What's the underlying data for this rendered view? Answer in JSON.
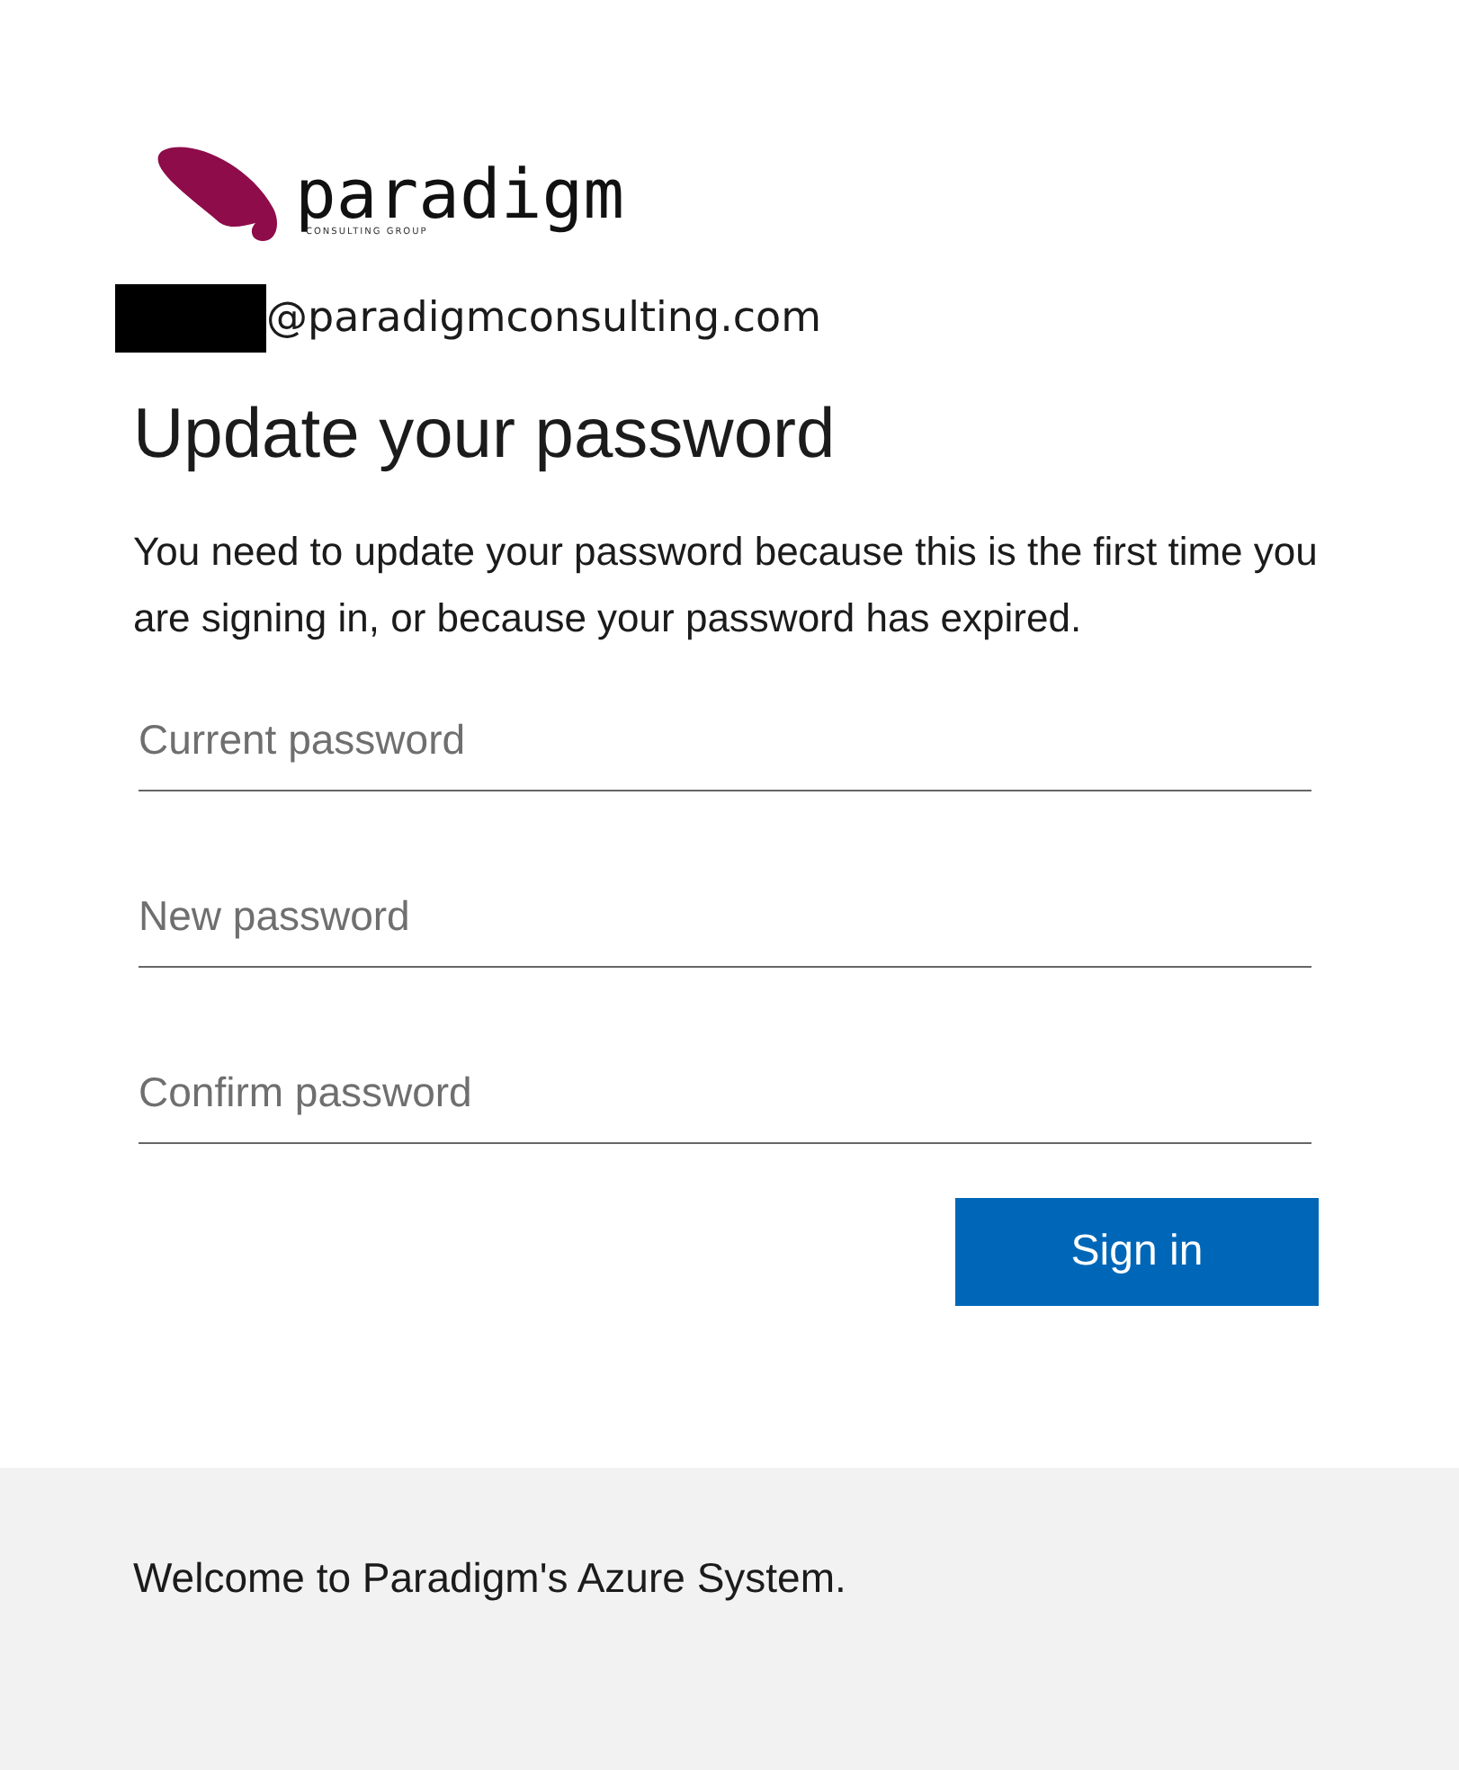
{
  "logo": {
    "name": "paradigm",
    "tagline": "CONSULTING GROUP"
  },
  "account": {
    "redacted": true,
    "email": "@paradigmconsulting.com"
  },
  "title": "Update your password",
  "description": "You need to update your password because this is the first time you are signing in, or because your password has expired.",
  "fields": [
    {
      "placeholder": "Current password"
    },
    {
      "placeholder": "New password"
    },
    {
      "placeholder": "Confirm password"
    }
  ],
  "submit": "Sign in",
  "footer": "Welcome to Paradigm's Azure System."
}
